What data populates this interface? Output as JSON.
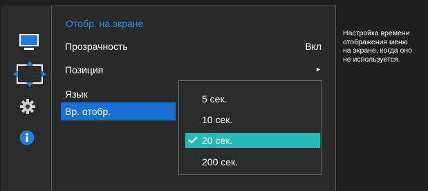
{
  "osd": {
    "menu_title": "Отобр. на экране",
    "items": [
      {
        "label": "Прозрачность",
        "value": "Вкл"
      },
      {
        "label": "Позиция",
        "arrow": "►"
      },
      {
        "label": "Язык"
      },
      {
        "label": "Вр. отобр."
      }
    ],
    "options": [
      "5 сек.",
      "10 сек.",
      "20 сек.",
      "200 сек."
    ],
    "selected_option": "20 сек.",
    "help_text": "Настройка времени\nотображения меню\nна экране, когда оно\nне используется."
  },
  "icons": [
    "display-icon",
    "position-icon",
    "gear-icon",
    "info-icon",
    "checkmark-icon"
  ],
  "colors": {
    "background": "#1f1f1f",
    "title_blue": "#2f8ee8",
    "selected_row": "#1a6fd4",
    "selected_option": "#27b8b6"
  }
}
